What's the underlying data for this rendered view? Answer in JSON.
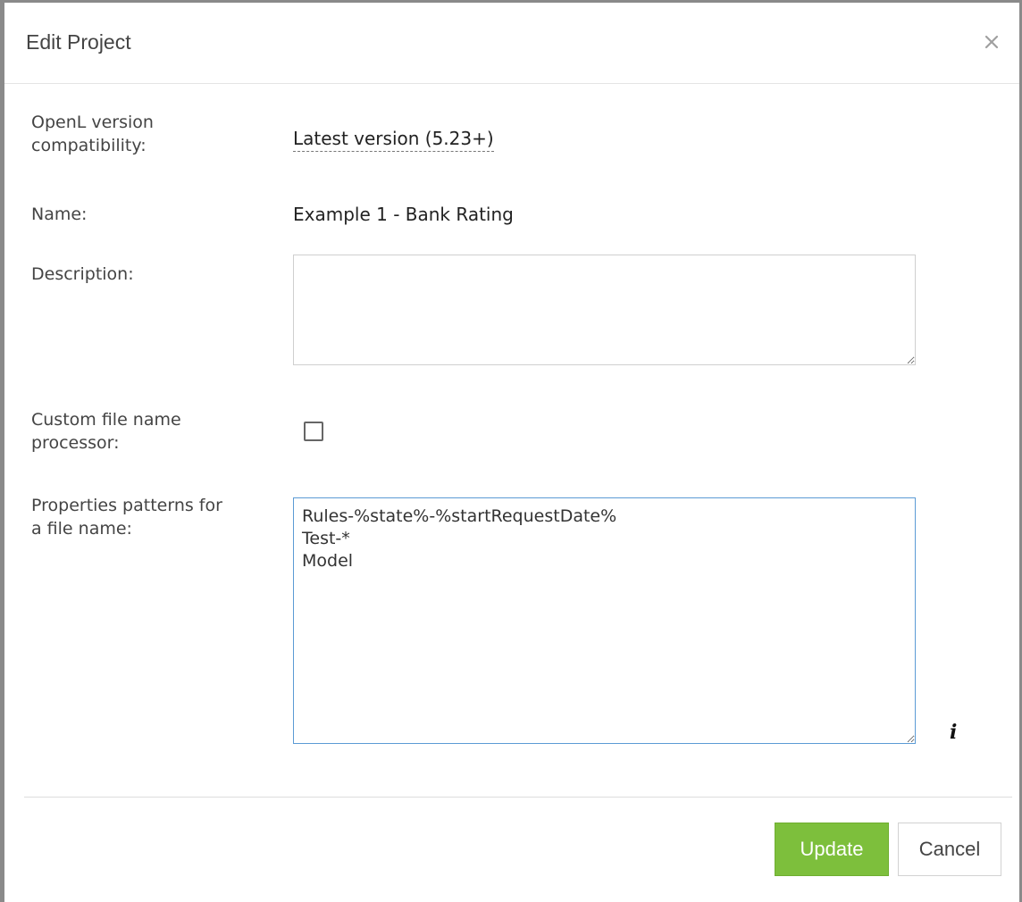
{
  "dialog": {
    "title": "Edit Project",
    "close_label": "×"
  },
  "fields": {
    "version": {
      "label_line1": "OpenL version",
      "label_line2": "compatibility:",
      "value": "Latest version (5.23+)"
    },
    "name": {
      "label": "Name:",
      "value": "Example 1 - Bank Rating"
    },
    "description": {
      "label": "Description:",
      "value": ""
    },
    "custom_processor": {
      "label_line1": "Custom file name",
      "label_line2": "processor:",
      "checked": false
    },
    "patterns": {
      "label_line1": "Properties patterns for",
      "label_line2": "a file name:",
      "value": "Rules-%state%-%startRequestDate%\nTest-*\nModel",
      "info_icon": "info-icon"
    }
  },
  "buttons": {
    "update": "Update",
    "cancel": "Cancel"
  },
  "colors": {
    "update_bg": "#7dbf3c",
    "focus_border": "#5b9bd5"
  }
}
